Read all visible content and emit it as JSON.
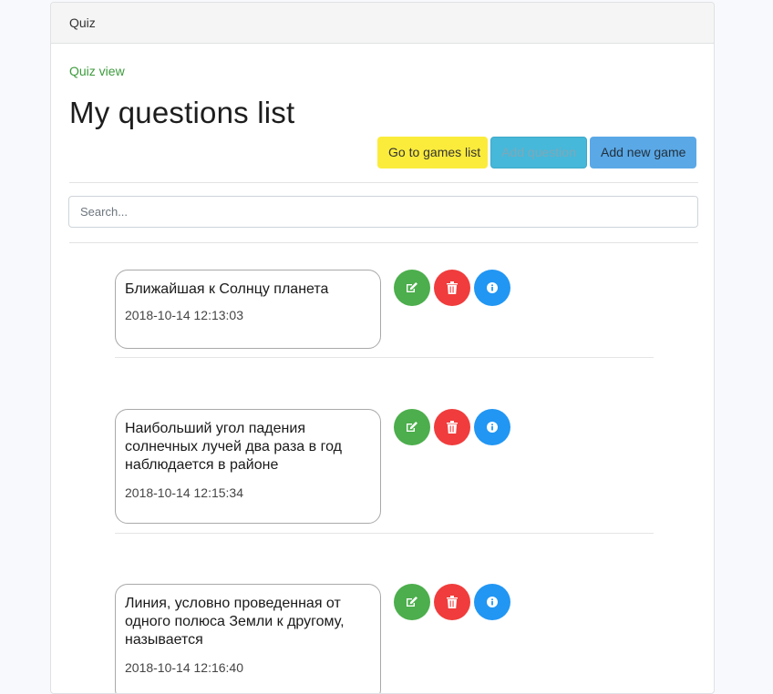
{
  "header": {
    "title": "Quiz"
  },
  "breadcrumb": {
    "link": "Quiz view"
  },
  "page": {
    "title": "My questions list"
  },
  "toolbar": {
    "games_list_label": "Go to games list",
    "add_question_label": "Add question",
    "add_game_label": "Add new game"
  },
  "search": {
    "placeholder": "Search...",
    "value": ""
  },
  "questions": [
    {
      "text": "Ближайшая к Солнцу планета",
      "date": "2018-10-14 12:13:03"
    },
    {
      "text": "Наибольший угол падения солнечных лучей два раза в год наблюдается в районе",
      "date": "2018-10-14 12:15:34"
    },
    {
      "text": "Линия, условно проведенная от одного полюса Земли к другому, называется",
      "date": "2018-10-14 12:16:40"
    }
  ],
  "icons": {
    "edit": "edit-icon",
    "delete": "trash-icon",
    "info": "info-icon"
  },
  "colors": {
    "edit": "#4cae4c",
    "delete": "#f03c3c",
    "info": "#2196f3",
    "link": "#3c9b3c",
    "games_button": "#fbec3c",
    "add_question_button": "#46b8da",
    "add_game_button": "#5aa8e6"
  }
}
